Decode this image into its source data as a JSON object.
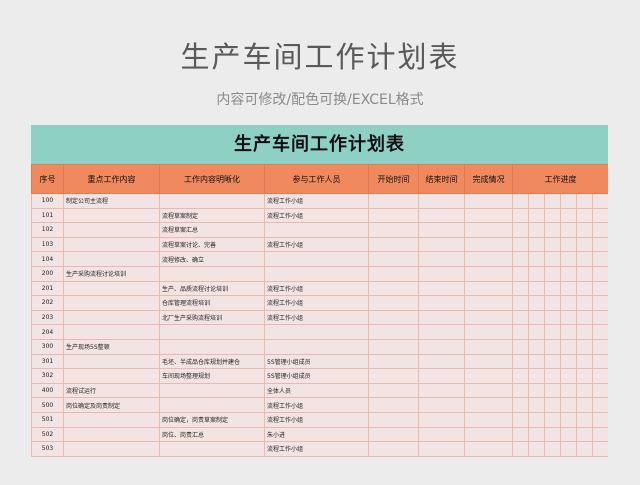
{
  "page": {
    "title": "生产车间工作计划表",
    "subtitle": "内容可修改/配色可换/EXCEL格式"
  },
  "sheet": {
    "banner": "生产车间工作计划表",
    "headers": {
      "seq": "序号",
      "key_work": "重点工作内容",
      "detail": "工作内容明晰化",
      "people": "参与工作人员",
      "start": "开始时间",
      "end": "结束时间",
      "status": "完成情况",
      "progress": "工作进度"
    },
    "colors": {
      "banner": "#8fd0c4",
      "header": "#f0895d",
      "row": "#f2e4e2"
    },
    "rows": [
      {
        "seq": "100",
        "key": "制定公司主流程",
        "detail": "",
        "people": "流程工作小组"
      },
      {
        "seq": "101",
        "key": "",
        "detail": "流程草案制定",
        "people": "流程工作小组"
      },
      {
        "seq": "102",
        "key": "",
        "detail": "流程草案汇总",
        "people": ""
      },
      {
        "seq": "103",
        "key": "",
        "detail": "流程草案讨论、完善",
        "people": "流程工作小组"
      },
      {
        "seq": "104",
        "key": "",
        "detail": "流程修改、确立",
        "people": ""
      },
      {
        "seq": "200",
        "key": "生产采购流程讨论培训",
        "detail": "",
        "people": ""
      },
      {
        "seq": "201",
        "key": "",
        "detail": "生产、品质流程讨论培训",
        "people": "流程工作小组"
      },
      {
        "seq": "202",
        "key": "",
        "detail": "仓库管理流程培训",
        "people": "流程工作小组"
      },
      {
        "seq": "203",
        "key": "",
        "detail": "北厂生产采购流程培训",
        "people": "流程工作小组"
      },
      {
        "seq": "204",
        "key": "",
        "detail": "",
        "people": ""
      },
      {
        "seq": "300",
        "key": "生产现场5S整顿",
        "detail": "",
        "people": ""
      },
      {
        "seq": "301",
        "key": "",
        "detail": "毛坯、半成品仓库规划并建仓",
        "people": "5S管理小组成员"
      },
      {
        "seq": "302",
        "key": "",
        "detail": "车间现场整理规划",
        "people": "5S管理小组成员"
      },
      {
        "seq": "400",
        "key": "流程试运行",
        "detail": "",
        "people": "全体人员"
      },
      {
        "seq": "500",
        "key": "岗位确定及岗责制定",
        "detail": "",
        "people": "流程工作小组"
      },
      {
        "seq": "501",
        "key": "",
        "detail": "岗位确定，岗责草案制定",
        "people": "流程工作小组"
      },
      {
        "seq": "502",
        "key": "",
        "detail": "岗位、岗责汇总",
        "people": "朱小进"
      },
      {
        "seq": "503",
        "key": "",
        "detail": "",
        "people": "流程工作小组"
      }
    ]
  }
}
